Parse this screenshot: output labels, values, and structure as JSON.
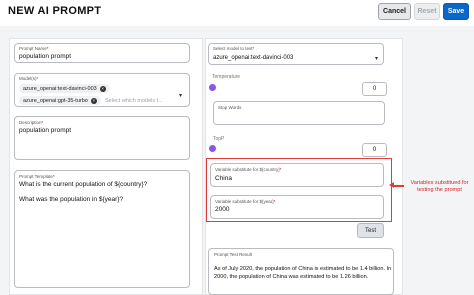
{
  "header": {
    "title": "NEW AI PROMPT",
    "cancel_label": "Cancel",
    "reset_label": "Reset",
    "save_label": "Save"
  },
  "form": {
    "prompt_name": {
      "label": "Prompt Name",
      "value": "population prompt"
    },
    "models": {
      "label": "Model(s)",
      "selected": [
        "azure_openai:text-davinci-003",
        "azure_openai:gpt-35-turbo"
      ],
      "placeholder": "Select which models t..."
    },
    "description": {
      "label": "Description",
      "value": "population prompt"
    },
    "prompt_template": {
      "label": "Prompt Template",
      "line1": "What is the current population of ${country}?",
      "line2": "What was the population in ${year}?"
    }
  },
  "test_panel": {
    "model_select": {
      "label": "Select model to test",
      "value": "azure_openai:text-davinci-003"
    },
    "temperature": {
      "label": "Temperature",
      "value": "0"
    },
    "stop_words": {
      "label": "Stop Words"
    },
    "top_p": {
      "label": "TopP",
      "value": "0"
    },
    "var_country": {
      "label": "Variable substitute for ${country}",
      "value": "China"
    },
    "var_year": {
      "label": "Variable substitute for ${year}",
      "value": "2000"
    },
    "test_label": "Test",
    "result": {
      "label": "Prompt Test Result",
      "text": "As of July 2020, the population of China is estimated to be 1.4 billion. In 2000, the population of China was estimated to be 1.26 billion."
    }
  },
  "annotation": {
    "text": "Variables substitued for testing the prompt"
  },
  "colors": {
    "accent": "#0b66c9",
    "slider": "#8a56e8",
    "highlight": "#e23b3b"
  }
}
